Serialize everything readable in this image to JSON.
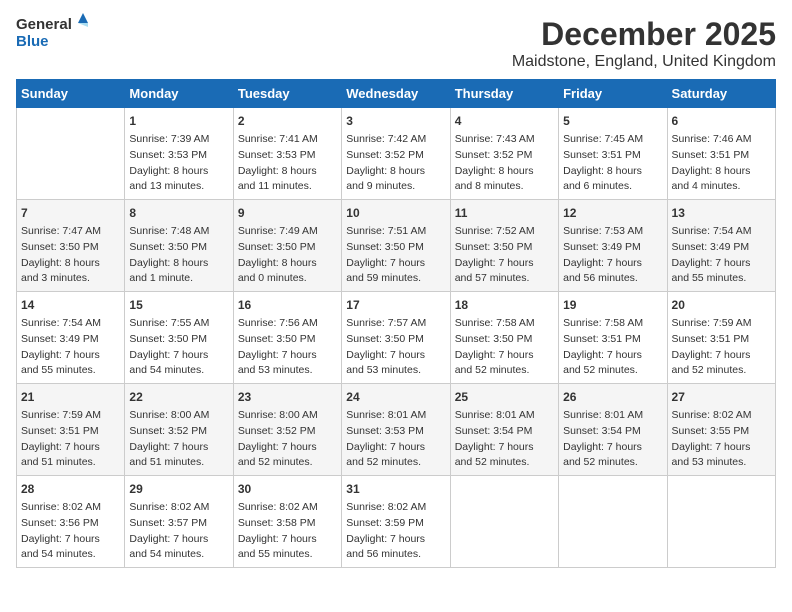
{
  "header": {
    "logo_line1": "General",
    "logo_line2": "Blue",
    "title": "December 2025",
    "subtitle": "Maidstone, England, United Kingdom"
  },
  "calendar": {
    "days_of_week": [
      "Sunday",
      "Monday",
      "Tuesday",
      "Wednesday",
      "Thursday",
      "Friday",
      "Saturday"
    ],
    "weeks": [
      [
        {
          "day": "",
          "info": ""
        },
        {
          "day": "1",
          "info": "Sunrise: 7:39 AM\nSunset: 3:53 PM\nDaylight: 8 hours\nand 13 minutes."
        },
        {
          "day": "2",
          "info": "Sunrise: 7:41 AM\nSunset: 3:53 PM\nDaylight: 8 hours\nand 11 minutes."
        },
        {
          "day": "3",
          "info": "Sunrise: 7:42 AM\nSunset: 3:52 PM\nDaylight: 8 hours\nand 9 minutes."
        },
        {
          "day": "4",
          "info": "Sunrise: 7:43 AM\nSunset: 3:52 PM\nDaylight: 8 hours\nand 8 minutes."
        },
        {
          "day": "5",
          "info": "Sunrise: 7:45 AM\nSunset: 3:51 PM\nDaylight: 8 hours\nand 6 minutes."
        },
        {
          "day": "6",
          "info": "Sunrise: 7:46 AM\nSunset: 3:51 PM\nDaylight: 8 hours\nand 4 minutes."
        }
      ],
      [
        {
          "day": "7",
          "info": "Sunrise: 7:47 AM\nSunset: 3:50 PM\nDaylight: 8 hours\nand 3 minutes."
        },
        {
          "day": "8",
          "info": "Sunrise: 7:48 AM\nSunset: 3:50 PM\nDaylight: 8 hours\nand 1 minute."
        },
        {
          "day": "9",
          "info": "Sunrise: 7:49 AM\nSunset: 3:50 PM\nDaylight: 8 hours\nand 0 minutes."
        },
        {
          "day": "10",
          "info": "Sunrise: 7:51 AM\nSunset: 3:50 PM\nDaylight: 7 hours\nand 59 minutes."
        },
        {
          "day": "11",
          "info": "Sunrise: 7:52 AM\nSunset: 3:50 PM\nDaylight: 7 hours\nand 57 minutes."
        },
        {
          "day": "12",
          "info": "Sunrise: 7:53 AM\nSunset: 3:49 PM\nDaylight: 7 hours\nand 56 minutes."
        },
        {
          "day": "13",
          "info": "Sunrise: 7:54 AM\nSunset: 3:49 PM\nDaylight: 7 hours\nand 55 minutes."
        }
      ],
      [
        {
          "day": "14",
          "info": "Sunrise: 7:54 AM\nSunset: 3:49 PM\nDaylight: 7 hours\nand 55 minutes."
        },
        {
          "day": "15",
          "info": "Sunrise: 7:55 AM\nSunset: 3:50 PM\nDaylight: 7 hours\nand 54 minutes."
        },
        {
          "day": "16",
          "info": "Sunrise: 7:56 AM\nSunset: 3:50 PM\nDaylight: 7 hours\nand 53 minutes."
        },
        {
          "day": "17",
          "info": "Sunrise: 7:57 AM\nSunset: 3:50 PM\nDaylight: 7 hours\nand 53 minutes."
        },
        {
          "day": "18",
          "info": "Sunrise: 7:58 AM\nSunset: 3:50 PM\nDaylight: 7 hours\nand 52 minutes."
        },
        {
          "day": "19",
          "info": "Sunrise: 7:58 AM\nSunset: 3:51 PM\nDaylight: 7 hours\nand 52 minutes."
        },
        {
          "day": "20",
          "info": "Sunrise: 7:59 AM\nSunset: 3:51 PM\nDaylight: 7 hours\nand 52 minutes."
        }
      ],
      [
        {
          "day": "21",
          "info": "Sunrise: 7:59 AM\nSunset: 3:51 PM\nDaylight: 7 hours\nand 51 minutes."
        },
        {
          "day": "22",
          "info": "Sunrise: 8:00 AM\nSunset: 3:52 PM\nDaylight: 7 hours\nand 51 minutes."
        },
        {
          "day": "23",
          "info": "Sunrise: 8:00 AM\nSunset: 3:52 PM\nDaylight: 7 hours\nand 52 minutes."
        },
        {
          "day": "24",
          "info": "Sunrise: 8:01 AM\nSunset: 3:53 PM\nDaylight: 7 hours\nand 52 minutes."
        },
        {
          "day": "25",
          "info": "Sunrise: 8:01 AM\nSunset: 3:54 PM\nDaylight: 7 hours\nand 52 minutes."
        },
        {
          "day": "26",
          "info": "Sunrise: 8:01 AM\nSunset: 3:54 PM\nDaylight: 7 hours\nand 52 minutes."
        },
        {
          "day": "27",
          "info": "Sunrise: 8:02 AM\nSunset: 3:55 PM\nDaylight: 7 hours\nand 53 minutes."
        }
      ],
      [
        {
          "day": "28",
          "info": "Sunrise: 8:02 AM\nSunset: 3:56 PM\nDaylight: 7 hours\nand 54 minutes."
        },
        {
          "day": "29",
          "info": "Sunrise: 8:02 AM\nSunset: 3:57 PM\nDaylight: 7 hours\nand 54 minutes."
        },
        {
          "day": "30",
          "info": "Sunrise: 8:02 AM\nSunset: 3:58 PM\nDaylight: 7 hours\nand 55 minutes."
        },
        {
          "day": "31",
          "info": "Sunrise: 8:02 AM\nSunset: 3:59 PM\nDaylight: 7 hours\nand 56 minutes."
        },
        {
          "day": "",
          "info": ""
        },
        {
          "day": "",
          "info": ""
        },
        {
          "day": "",
          "info": ""
        }
      ]
    ]
  }
}
